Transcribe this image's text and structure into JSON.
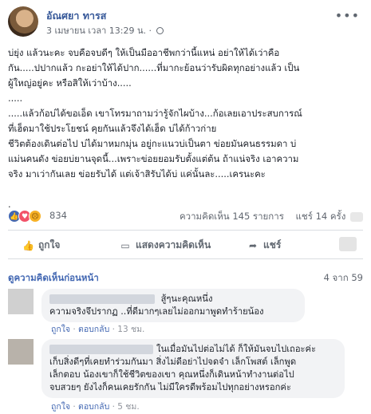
{
  "author": {
    "name": "อัณศยา ทารส",
    "timestamp": "3 เมษายน เวลา 13:29 น."
  },
  "body": "บ่ยุ่ง แล้วนะคะ จบคือจบดีๆ ให้เป็นมืออาชีพกว่านี้แหน่ อย่าให้ได้เว่าคือ\nกัน.....ปปากแล้ว กะอย่าให้ได้ปาก......ที่มากะย้อนว่ารับผิดทุกอย่างแล้ว เป็น\nผู้ใหญ่อยู่คะ หรือสิให้เว่าบ้าง.....\n.....\n.....แล้วก้อบ่ได้ขอเอ็ด เขาโทรมาถามว่ารู้จักไผบ้าง...ก้อเลยเอาประสบการณ์\nที่เฮ็ดมาใช้ประโยชน์ คุยกันแล้วจึงได้เฮ็ด บ่ได้ก้าวก่าย\nชีวิตต้องเดินต่อไป บ่ได้มาหมกมุ่น อยู่กะแนวบ่เป็นตา ข่อยมันคนธรรมดา บ่\nแม่นคนดัง ข่อยบ่ยานจุดนี้...เพราะข่อยยอมรับตั้งแต่ต้น ถ้าแน่จริง เอาความ\nจริง มาเว่ากันเลย ข่อยรับได้ แต่เจ้าสิรับได้บ่ แค่นั้นละ.....เครนะคะ\n\n.",
  "stats": {
    "reaction_count": "834",
    "comments": "ความคิดเห็น 145 รายการ",
    "shares": "แชร์ 14 ครั้ง"
  },
  "actions": {
    "like": "ถูกใจ",
    "comment": "แสดงความคิดเห็น",
    "share": "แชร์"
  },
  "comments_header": {
    "label": "ดูความคิดเห็นก่อนหน้า",
    "count": "4 จาก 59"
  },
  "comments": [
    {
      "text_line1": "สู้ๆนะคุณหนึ่ง",
      "text_line2": "ความจริงจึปรากฏ ..ที่ดีมากๆเลยไม่ออกมาพูดทำร้ายน้อง",
      "like": "ถูกใจ",
      "reply": "ตอบกลับ",
      "time": "13 ชม."
    },
    {
      "text": "ในเมื่อมันไปต่อไม่ได้ ก็ให้มันจบไปเถอะค่ะ\nเก็บสิ่งดีๆที่เคยทำร่วมกันมา สิ่งไม่ดีอย่าไปจดจำ เล็กโพสต์ เล็กพูด\nเล็กตอบ น้องเขาก็ใช้ชีวิตของเขา คุณหนึ่งก็เดินหน้าทำงานต่อไป\nจบสวยๆ ยังไงก็คนเคยรักกัน ไม่มีใครดีพร้อมไปทุกอย่างหรอกค่ะ",
      "like": "ถูกใจ",
      "reply": "ตอบกลับ",
      "time": "5 ชม."
    }
  ]
}
